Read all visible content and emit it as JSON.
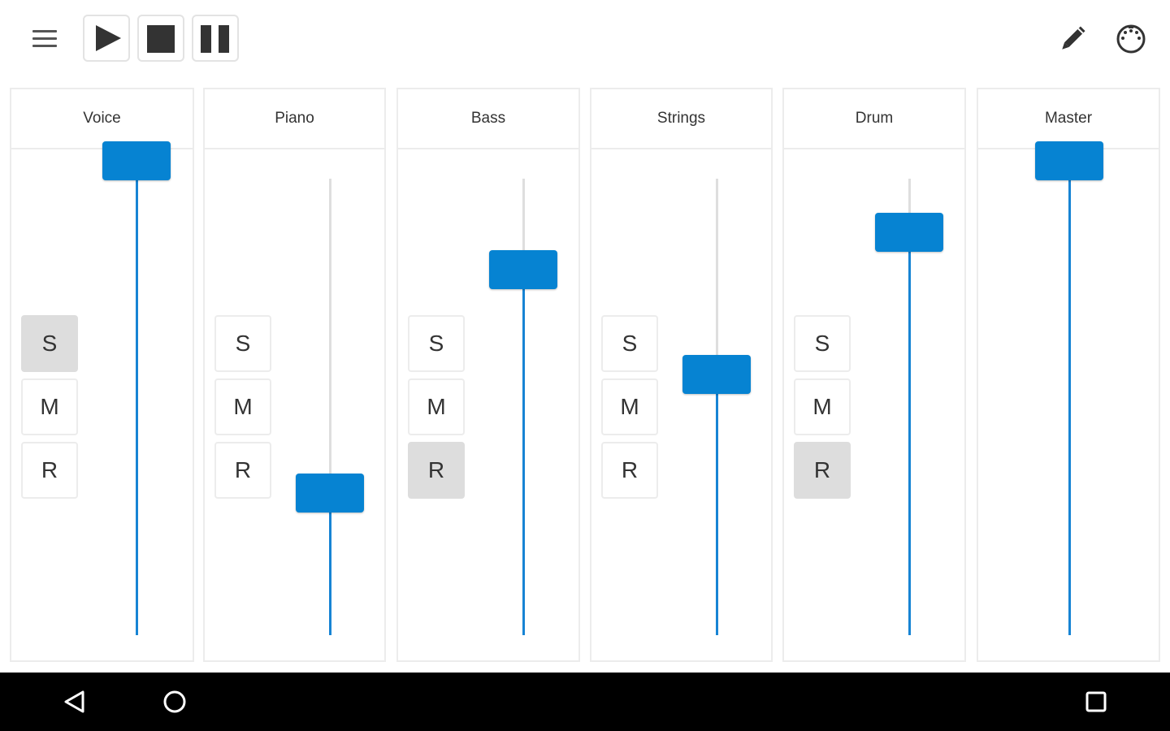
{
  "toolbar": {
    "icons": {
      "menu": "hamburger-menu-icon",
      "play": "play-icon",
      "stop": "stop-icon",
      "pause": "pause-icon",
      "edit": "pencil-icon",
      "midi": "midi-connector-icon"
    }
  },
  "colors": {
    "accent": "#0683d2",
    "fill_line": "#1784d4",
    "toggle_active": "#dddddd",
    "border": "#ececec"
  },
  "channels": [
    {
      "name": "Voice",
      "solo": "S",
      "mute": "M",
      "record": "R",
      "solo_on": true,
      "mute_on": false,
      "record_on": false,
      "level": 1.0
    },
    {
      "name": "Piano",
      "solo": "S",
      "mute": "M",
      "record": "R",
      "solo_on": false,
      "mute_on": false,
      "record_on": false,
      "level": 0.3
    },
    {
      "name": "Bass",
      "solo": "S",
      "mute": "M",
      "record": "R",
      "solo_on": false,
      "mute_on": false,
      "record_on": true,
      "level": 0.77
    },
    {
      "name": "Strings",
      "solo": "S",
      "mute": "M",
      "record": "R",
      "solo_on": false,
      "mute_on": false,
      "record_on": false,
      "level": 0.55
    },
    {
      "name": "Drum",
      "solo": "S",
      "mute": "M",
      "record": "R",
      "solo_on": false,
      "mute_on": false,
      "record_on": true,
      "level": 0.85
    }
  ],
  "master": {
    "name": "Master",
    "level": 1.0
  },
  "navbar": {
    "icons": {
      "back": "back-triangle-icon",
      "home": "home-circle-icon",
      "recent": "recent-apps-square-icon"
    }
  }
}
